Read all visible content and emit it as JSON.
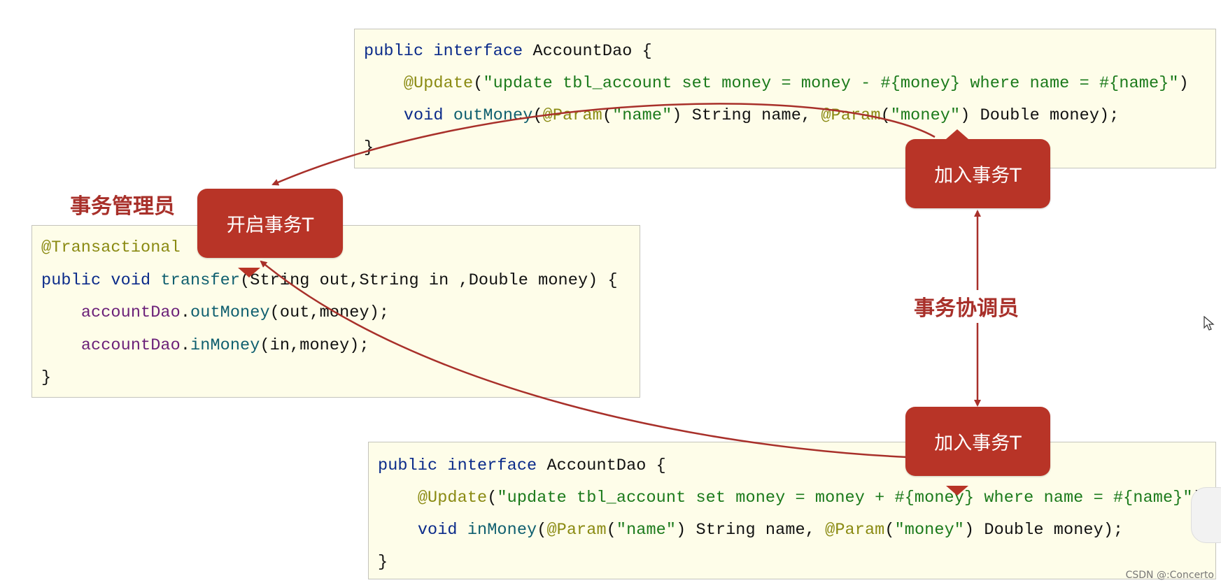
{
  "colors": {
    "bubble": "#b83427",
    "role_text": "#a8302a",
    "arrow": "#a8302a",
    "code_bg": "#fefde9",
    "keyword": "#0b2b8a",
    "annotation": "#8a8a12",
    "string": "#1b7a1b"
  },
  "roles": {
    "manager": "事务管理员",
    "coordinator": "事务协调员"
  },
  "bubbles": {
    "begin": "开启事务T",
    "join_top": "加入事务T",
    "join_bottom": "加入事务T"
  },
  "code_top": [
    [
      [
        "kw",
        "public "
      ],
      [
        "kw",
        "interface "
      ],
      [
        "plain",
        "AccountDao {"
      ]
    ],
    [
      [
        "plain",
        "    "
      ],
      [
        "ann",
        "@Update"
      ],
      [
        "plain",
        "("
      ],
      [
        "str",
        "\"update tbl_account set money = money - #{money} where name = #{name}\""
      ],
      [
        "plain",
        ")"
      ]
    ],
    [
      [
        "plain",
        "    "
      ],
      [
        "kw",
        "void "
      ],
      [
        "fn",
        "outMoney"
      ],
      [
        "plain",
        "("
      ],
      [
        "ann",
        "@Param"
      ],
      [
        "plain",
        "("
      ],
      [
        "str",
        "\"name\""
      ],
      [
        "plain",
        ") String name, "
      ],
      [
        "ann",
        "@Param"
      ],
      [
        "plain",
        "("
      ],
      [
        "str",
        "\"money\""
      ],
      [
        "plain",
        ") Double money);"
      ]
    ],
    [
      [
        "plain",
        "}"
      ]
    ]
  ],
  "code_left": [
    [
      [
        "ann",
        "@Transactional"
      ]
    ],
    [
      [
        "kw",
        "public "
      ],
      [
        "kw",
        "void "
      ],
      [
        "fn",
        "transfer"
      ],
      [
        "plain",
        "(String out,String in ,Double money) {"
      ]
    ],
    [
      [
        "plain",
        "    "
      ],
      [
        "fld",
        "accountDao"
      ],
      [
        "plain",
        "."
      ],
      [
        "fn",
        "outMoney"
      ],
      [
        "plain",
        "(out,money);"
      ]
    ],
    [
      [
        "plain",
        "    "
      ],
      [
        "fld",
        "accountDao"
      ],
      [
        "plain",
        "."
      ],
      [
        "fn",
        "inMoney"
      ],
      [
        "plain",
        "(in,money);"
      ]
    ],
    [
      [
        "plain",
        "}"
      ]
    ]
  ],
  "code_bottom": [
    [
      [
        "kw",
        "public "
      ],
      [
        "kw",
        "interface "
      ],
      [
        "plain",
        "AccountDao {"
      ]
    ],
    [
      [
        "plain",
        "    "
      ],
      [
        "ann",
        "@Update"
      ],
      [
        "plain",
        "("
      ],
      [
        "str",
        "\"update tbl_account set money = money + #{money} where name = #{name}\""
      ],
      [
        "plain",
        ")"
      ]
    ],
    [
      [
        "plain",
        "    "
      ],
      [
        "kw",
        "void "
      ],
      [
        "fn",
        "inMoney"
      ],
      [
        "plain",
        "("
      ],
      [
        "ann",
        "@Param"
      ],
      [
        "plain",
        "("
      ],
      [
        "str",
        "\"name\""
      ],
      [
        "plain",
        ") String name, "
      ],
      [
        "ann",
        "@Param"
      ],
      [
        "plain",
        "("
      ],
      [
        "str",
        "\"money\""
      ],
      [
        "plain",
        ") Double money);"
      ]
    ],
    [
      [
        "plain",
        "}"
      ]
    ]
  ],
  "watermark": "CSDN @:Concerto",
  "icons": {
    "cursor": "mouse-pointer-icon"
  }
}
